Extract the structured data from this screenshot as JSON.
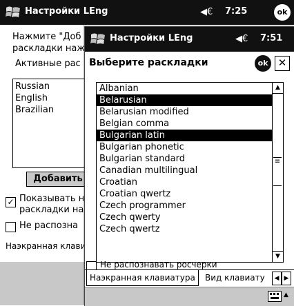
{
  "back": {
    "title": "Настройки LEng",
    "time": "7:25",
    "ok": "ok",
    "prompt_line1": "Нажмите \"Доб",
    "prompt_line2": "раскладки наж",
    "active_label": "Активные рас",
    "active_layouts": [
      "Russian",
      "English",
      "Brazilian"
    ],
    "add_button": "Добавить",
    "show_check_line1": "Показывать н",
    "show_check_line2": "раскладки на",
    "no_strokes_label": "Не распозна",
    "tab_label": "Наэкранная клави"
  },
  "front": {
    "title": "Настройки LEng",
    "time": "7:51",
    "ok": "ok",
    "header": "Выберите раскладки",
    "close": "✕",
    "layouts": [
      {
        "name": "Albanian",
        "selected": false
      },
      {
        "name": "Belarusian",
        "selected": true
      },
      {
        "name": "Belarusian modified",
        "selected": false
      },
      {
        "name": "Belgian comma",
        "selected": false
      },
      {
        "name": "Bulgarian latin",
        "selected": true
      },
      {
        "name": "Bulgarian phonetic",
        "selected": false
      },
      {
        "name": "Bulgarian standard",
        "selected": false
      },
      {
        "name": "Canadian multilingual",
        "selected": false
      },
      {
        "name": "Croatian",
        "selected": false
      },
      {
        "name": "Croatian qwertz",
        "selected": false
      },
      {
        "name": "Czech programmer",
        "selected": false
      },
      {
        "name": "Czech qwerty",
        "selected": false
      },
      {
        "name": "Czech qwertz",
        "selected": false
      }
    ],
    "hidden_check_label": "Не распознавать росчерки",
    "tab1": "Наэкранная клавиатура",
    "tab2": "Вид клавиату",
    "tab_prev": "◀",
    "tab_next": "▶",
    "scroll_up": "▲",
    "scroll_down": "▼",
    "keyboard_icon": "keyboard-icon"
  }
}
